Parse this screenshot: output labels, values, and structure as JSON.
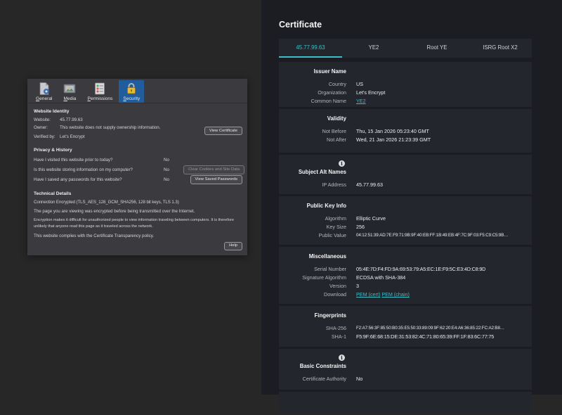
{
  "colors": {
    "accent_teal": "#3cbfc6",
    "selected_tab_blue": "#215d9c",
    "panel_background": "#1b1d23",
    "card_background": "#24262d",
    "dialog_background": "#3b3b3f"
  },
  "page_info": {
    "tabs": [
      {
        "label": "General",
        "icon": "document-icon",
        "selected": false
      },
      {
        "label": "Media",
        "icon": "media-icon",
        "selected": false
      },
      {
        "label": "Permissions",
        "icon": "permissions-icon",
        "selected": false
      },
      {
        "label": "Security",
        "icon": "lock-icon",
        "selected": true
      }
    ],
    "website_identity": {
      "title": "Website Identity",
      "website_label": "Website:",
      "website_value": "45.77.99.63",
      "owner_label": "Owner:",
      "owner_value": "This website does not supply ownership information.",
      "verified_label": "Verified by:",
      "verified_value": "Let's Encrypt",
      "view_certificate_button": "View Certificate"
    },
    "privacy_history": {
      "title": "Privacy & History",
      "rows": [
        {
          "question": "Have I visited this website prior to today?",
          "answer": "No",
          "button": ""
        },
        {
          "question": "Is this website storing information on my computer?",
          "answer": "No",
          "button": "Clear Cookies and Site Data"
        },
        {
          "question": "Have I saved any passwords for this website?",
          "answer": "No",
          "button": "View Saved Passwords"
        }
      ]
    },
    "technical_details": {
      "title": "Technical Details",
      "lines": [
        "Connection Encrypted (TLS_AES_128_GCM_SHA256, 128 bit keys, TLS 1.3)",
        "The page you are viewing was encrypted before being transmitted over the Internet.",
        "Encryption makes it difficult for unauthorized people to view information traveling between computers. It is therefore unlikely that anyone read this page as it traveled across the network.",
        "This website complies with the Certificate Transparency policy."
      ],
      "help_button": "Help"
    }
  },
  "certificate": {
    "title": "Certificate",
    "tabs": [
      {
        "label": "45.77.99.63",
        "active": true
      },
      {
        "label": "YE2",
        "active": false
      },
      {
        "label": "Root YE",
        "active": false
      },
      {
        "label": "ISRG Root X2",
        "active": false
      }
    ],
    "sections": {
      "issuer_name": {
        "title": "Issuer Name",
        "rows": [
          {
            "label": "Country",
            "value": "US"
          },
          {
            "label": "Organization",
            "value": "Let's Encrypt"
          },
          {
            "label": "Common Name",
            "value": "YE2"
          }
        ]
      },
      "validity": {
        "title": "Validity",
        "rows": [
          {
            "label": "Not Before",
            "value": "Thu, 15 Jan 2026 05:23:40 GMT"
          },
          {
            "label": "Not After",
            "value": "Wed, 21 Jan 2026 21:23:39 GMT"
          }
        ]
      },
      "subject_alt_names": {
        "title": "Subject Alt Names",
        "info_icon": "info-icon",
        "rows": [
          {
            "label": "IP Address",
            "value": "45.77.99.63"
          }
        ]
      },
      "public_key_info": {
        "title": "Public Key Info",
        "rows": [
          {
            "label": "Algorithm",
            "value": "Elliptic Curve"
          },
          {
            "label": "Key Size",
            "value": "256"
          },
          {
            "label": "Public Value",
            "value": "04:12:51:39:AD:7E:F9:71:9B:9F:40:EB:FF:1B:49:EB:4F:7C:9F:03:F5:C9:C5:9B…"
          }
        ]
      },
      "miscellaneous": {
        "title": "Miscellaneous",
        "rows": [
          {
            "label": "Serial Number",
            "value": "05:4E:7D:F4:FD:9A:69:53:79:A5:EC:1E:F9:5C:E3:4D:C8:9D"
          },
          {
            "label": "Signature Algorithm",
            "value": "ECDSA with SHA-384"
          },
          {
            "label": "Version",
            "value": "3"
          }
        ],
        "download_label": "Download",
        "download_links": [
          "PEM (cert)",
          "PEM (chain)"
        ]
      },
      "fingerprints": {
        "title": "Fingerprints",
        "rows": [
          {
            "label": "SHA-256",
            "value": "F2:A7:56:3F:85:50:B0:35:E5:50:33:89:09:9F:62:20:E4:A6:36:85:22:FC:A2:B8…"
          },
          {
            "label": "SHA-1",
            "value": "F5:9F:6E:68:15:DE:31:53:82:4C:71:80:65:39:FF:1F:83:6C:77:75"
          }
        ]
      },
      "basic_constraints": {
        "title": "Basic Constraints",
        "info_icon": "info-icon",
        "rows": [
          {
            "label": "Certificate Authority",
            "value": "No"
          }
        ]
      }
    }
  }
}
